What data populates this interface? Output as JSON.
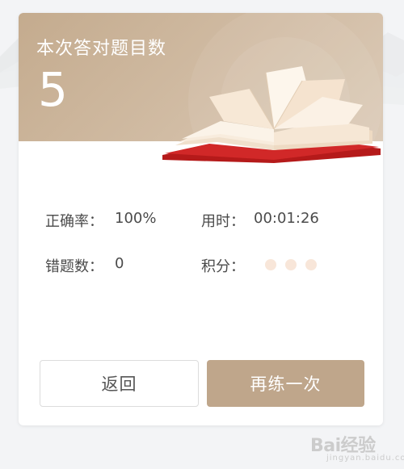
{
  "summary": {
    "title": "本次答对题目数",
    "count": "5"
  },
  "stats": {
    "accuracy_label": "正确率：",
    "accuracy_value": "100%",
    "time_label": "用时：",
    "time_value": "00:01:26",
    "wrong_label": "错题数：",
    "wrong_value": "0",
    "points_label": "积分："
  },
  "buttons": {
    "back_label": "返回",
    "retry_label": "再练一次"
  },
  "watermark": {
    "text": "Bai经验",
    "sub": "jingyan.baidu.com"
  },
  "colors": {
    "banner": "#c4ab8e",
    "retry_button": "#bfa68b",
    "book_cover": "#c81e1e",
    "loading_dot": "#f8e6d9"
  },
  "icons": {
    "banner_illustration": "open-book-icon",
    "points_indicator": "loading-dots-icon"
  }
}
